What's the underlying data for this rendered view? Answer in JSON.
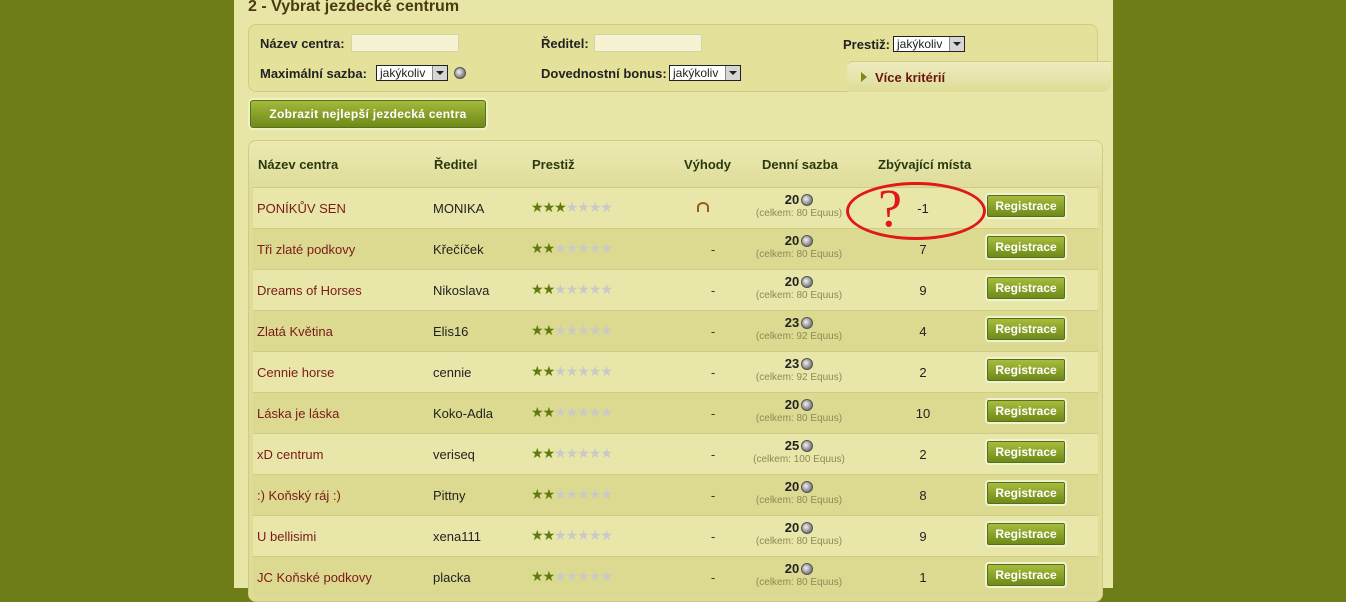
{
  "page": {
    "title": "2 - Vybrat jezdecké centrum"
  },
  "filters": {
    "name_label": "Název centra:",
    "director_label": "Ředitel:",
    "prestige_label": "Prestiž:",
    "prestige_value": "jakýkoliv",
    "max_rate_label": "Maximální sazba:",
    "max_rate_value": "jakýkoliv",
    "skill_bonus_label": "Dovednostní bonus:",
    "skill_bonus_value": "jakýkoliv",
    "more_criteria": "Více kritérií"
  },
  "show_best_button": "Zobrazit nejlepší jezdecká centra",
  "table": {
    "headers": {
      "name": "Název centra",
      "director": "Ředitel",
      "prestige": "Prestiž",
      "advantages": "Výhody",
      "daily_rate": "Denní sazba",
      "free_places": "Zbývající místa"
    },
    "register_label": "Registrace",
    "stars_total": 7,
    "rows": [
      {
        "name": "PONÍKŮV  SEN",
        "director": "MONIKA",
        "stars": 3,
        "advantage": "",
        "advantage_icon": "horseshoe-icon",
        "rate": "20",
        "rate_total": "(celkem: 80 Equus)",
        "free": "-1"
      },
      {
        "name": "Tři zlaté podkovy",
        "director": "Křečíček",
        "stars": 2,
        "advantage": "-",
        "rate": "20",
        "rate_total": "(celkem: 80 Equus)",
        "free": "7"
      },
      {
        "name": "Dreams of Horses",
        "director": "Nikoslava",
        "stars": 2,
        "advantage": "-",
        "rate": "20",
        "rate_total": "(celkem: 80 Equus)",
        "free": "9"
      },
      {
        "name": "Zlatá Květina",
        "director": "Elis16",
        "stars": 2,
        "advantage": "-",
        "rate": "23",
        "rate_total": "(celkem: 92 Equus)",
        "free": "4"
      },
      {
        "name": "Cennie horse",
        "director": "cennie",
        "stars": 2,
        "advantage": "-",
        "rate": "23",
        "rate_total": "(celkem: 92 Equus)",
        "free": "2"
      },
      {
        "name": "Láska je láska",
        "director": "Koko-Adla",
        "stars": 2,
        "advantage": "-",
        "rate": "20",
        "rate_total": "(celkem: 80 Equus)",
        "free": "10"
      },
      {
        "name": "xD centrum",
        "director": "veriseq",
        "stars": 2,
        "advantage": "-",
        "rate": "25",
        "rate_total": "(celkem: 100 Equus)",
        "free": "2"
      },
      {
        "name": ":) Koňský ráj :)",
        "director": "Pittny",
        "stars": 2,
        "advantage": "-",
        "rate": "20",
        "rate_total": "(celkem: 80 Equus)",
        "free": "8"
      },
      {
        "name": "U bellisimi",
        "director": "xena111",
        "stars": 2,
        "advantage": "-",
        "rate": "20",
        "rate_total": "(celkem: 80 Equus)",
        "free": "9"
      },
      {
        "name": "JC Koňské podkovy",
        "director": "placka",
        "stars": 2,
        "advantage": "-",
        "rate": "20",
        "rate_total": "(celkem: 80 Equus)",
        "free": "1"
      }
    ]
  },
  "annotation": {
    "text": "?",
    "color": "#e01818"
  },
  "colors": {
    "accent": "#6f891a",
    "link": "#7a1a1a",
    "background": "#6e7d18",
    "panel": "#e8e6a6"
  }
}
